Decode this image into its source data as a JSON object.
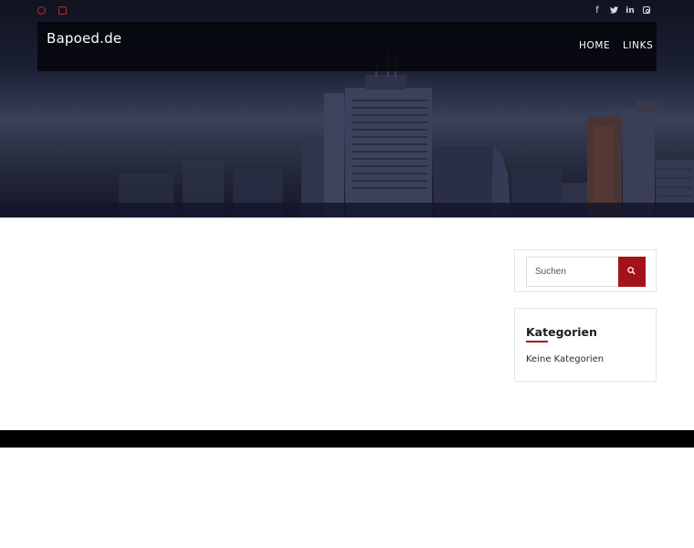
{
  "topbar": {
    "left_icons": [
      "clock-icon",
      "mail-icon"
    ],
    "social": [
      {
        "name": "facebook-icon",
        "glyph": "f"
      },
      {
        "name": "twitter-icon",
        "glyph": "t"
      },
      {
        "name": "linkedin-icon",
        "glyph": "in"
      },
      {
        "name": "instagram-icon",
        "glyph": ""
      }
    ]
  },
  "header": {
    "brand": "Bapoed.de",
    "nav": [
      {
        "label": "HOME"
      },
      {
        "label": "LINKS"
      }
    ]
  },
  "sidebar": {
    "search": {
      "placeholder": "Suchen",
      "button_icon": "search-icon"
    },
    "categories": {
      "title": "Kategorien",
      "empty_text": "Keine Kategorien"
    }
  },
  "colors": {
    "accent": "#a3131b",
    "navbar_bg": "#06070c",
    "footer_bg": "#000000"
  }
}
